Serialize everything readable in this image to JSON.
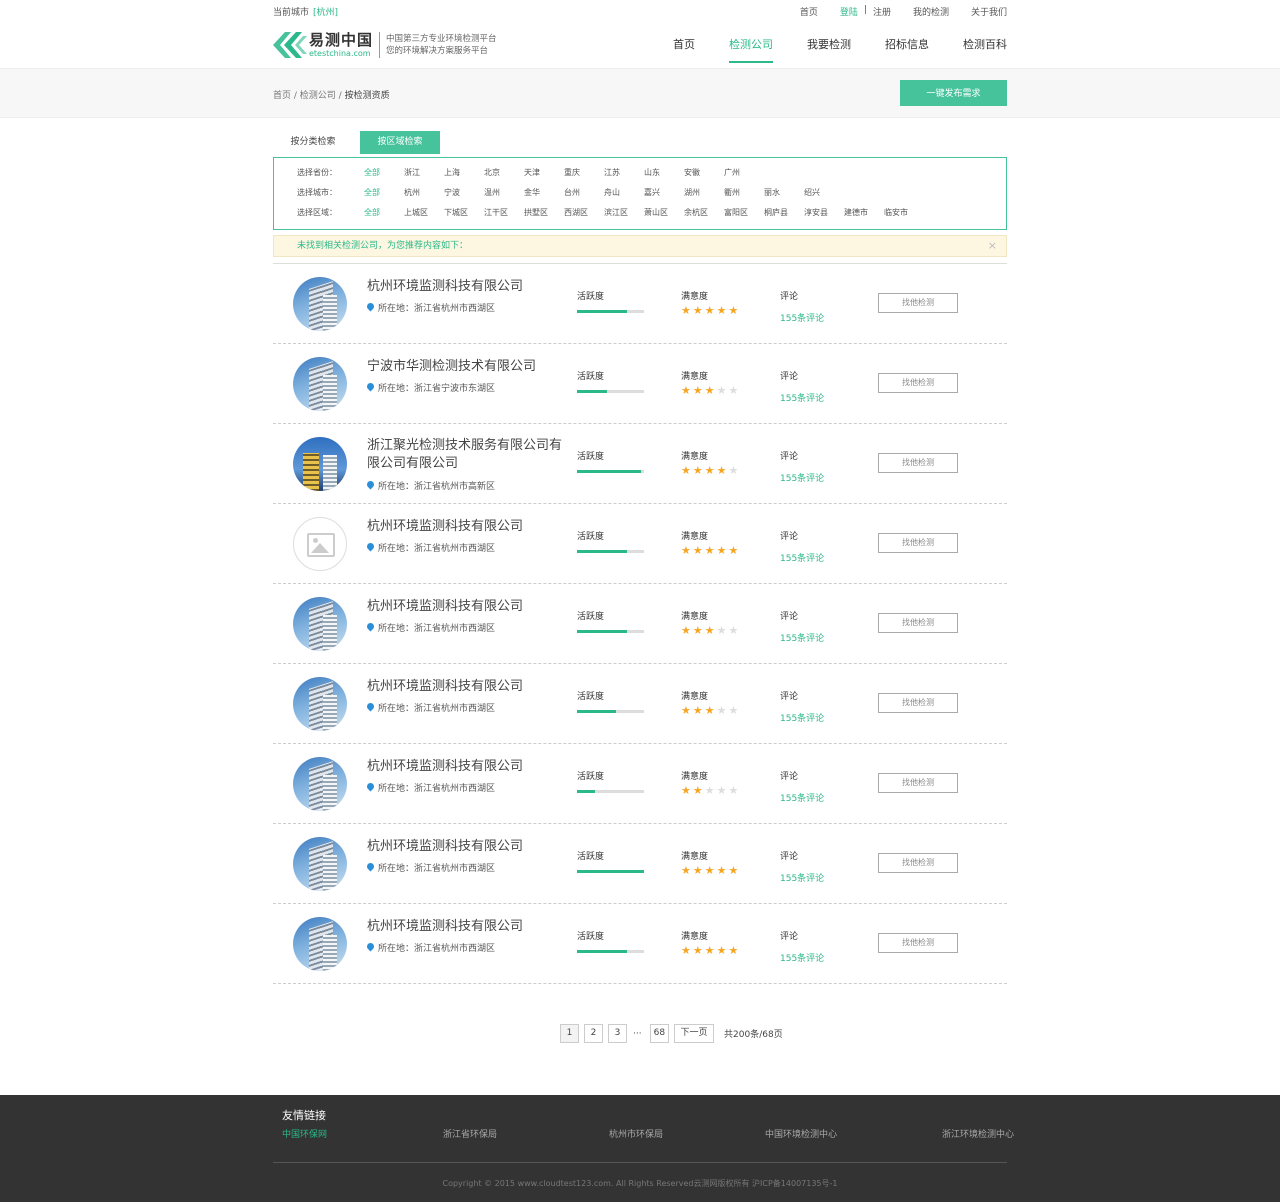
{
  "topbar": {
    "city_label": "当前城市",
    "city_value": "[杭州]",
    "links": [
      "首页",
      "登陆",
      "|",
      "注册",
      "我的检测",
      "关于我们"
    ]
  },
  "logo": {
    "cn": "易测中国",
    "en": "etestchina.com",
    "slogan1": "中国第三方专业环境检测平台",
    "slogan2": "您的环境解决方案服务平台"
  },
  "nav": [
    "首页",
    "检测公司",
    "我要检测",
    "招标信息",
    "检测百科"
  ],
  "breadcrumb": {
    "a": "首页",
    "b": "检测公司",
    "c": "按检测资质",
    "sep": " / "
  },
  "publish_label": "一键发布需求",
  "tabs": [
    "按分类检索",
    "按区域检索"
  ],
  "filter": {
    "province_label": "选择省份：",
    "provinces": [
      "全部",
      "浙江",
      "上海",
      "北京",
      "天津",
      "重庆",
      "江苏",
      "山东",
      "安徽",
      "广州"
    ],
    "city_label": "选择城市：",
    "cities": [
      "全部",
      "杭州",
      "宁波",
      "温州",
      "金华",
      "台州",
      "舟山",
      "嘉兴",
      "湖州",
      "衢州",
      "丽水",
      "绍兴"
    ],
    "district_label": "选择区域：",
    "districts": [
      "全部",
      "上城区",
      "下城区",
      "江干区",
      "拱墅区",
      "西湖区",
      "滨江区",
      "萧山区",
      "余杭区",
      "富阳区",
      "桐庐县",
      "淳安县",
      "建德市",
      "临安市"
    ]
  },
  "notice": "未找到相关检测公司，为您推荐内容如下：",
  "labels": {
    "activity": "活跃度",
    "satisfaction": "满意度",
    "comments": "评论",
    "find": "找他检测",
    "loc_prefix": "所在地："
  },
  "companies": [
    {
      "name": "杭州环境监测科技有限公司",
      "location": "浙江省杭州市西湖区",
      "activity": 0.75,
      "stars": 5,
      "comments": "155条评论",
      "img": "building"
    },
    {
      "name": "宁波市华测检测技术有限公司",
      "location": "浙江省宁波市东湖区",
      "activity": 0.45,
      "stars": 3,
      "comments": "155条评论",
      "img": "building"
    },
    {
      "name": "浙江聚光检测技术服务有限公司有限公司有限公司",
      "location": "浙江省杭州市高新区",
      "activity": 0.95,
      "stars": 4,
      "comments": "155条评论",
      "img": "yellow"
    },
    {
      "name": "杭州环境监测科技有限公司",
      "location": "浙江省杭州市西湖区",
      "activity": 0.75,
      "stars": 5,
      "comments": "155条评论",
      "img": "placeholder"
    },
    {
      "name": "杭州环境监测科技有限公司",
      "location": "浙江省杭州市西湖区",
      "activity": 0.75,
      "stars": 3,
      "comments": "155条评论",
      "img": "building"
    },
    {
      "name": "杭州环境监测科技有限公司",
      "location": "浙江省杭州市西湖区",
      "activity": 0.58,
      "stars": 3,
      "comments": "155条评论",
      "img": "building"
    },
    {
      "name": "杭州环境监测科技有限公司",
      "location": "浙江省杭州市西湖区",
      "activity": 0.27,
      "stars": 2,
      "comments": "155条评论",
      "img": "building"
    },
    {
      "name": "杭州环境监测科技有限公司",
      "location": "浙江省杭州市西湖区",
      "activity": 1.0,
      "stars": 5,
      "comments": "155条评论",
      "img": "building"
    },
    {
      "name": "杭州环境监测科技有限公司",
      "location": "浙江省杭州市西湖区",
      "activity": 0.75,
      "stars": 5,
      "comments": "155条评论",
      "img": "building"
    }
  ],
  "pager": {
    "pages": [
      "1",
      "2",
      "3"
    ],
    "dots": "···",
    "last": "68",
    "next": "下一页",
    "total": "共200条/68页",
    "current": "1"
  },
  "footer": {
    "title": "友情链接",
    "links": [
      "中国环保网",
      "浙江省环保局",
      "杭州市环保局",
      "中国环境检测中心",
      "浙江环境检测中心"
    ],
    "copyright": "Copyright © 2015 www.cloudtest123.com. All Rights Reserved云测网版权所有 沪ICP备14007135号-1"
  },
  "colors": {
    "accent": "#46c39b",
    "accent_text": "#2bb88a",
    "star": "#f5a623",
    "footer_bg": "#333333"
  }
}
